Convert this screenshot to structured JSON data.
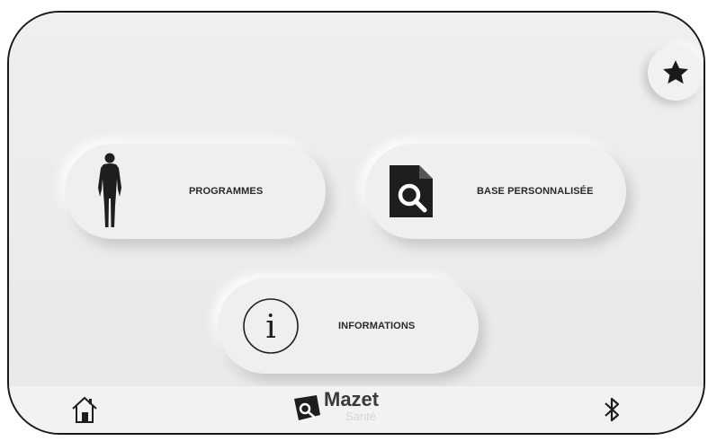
{
  "menu": {
    "programmes_label": "PROGRAMMES",
    "base_label": "BASE PERSONNALISÉE",
    "info_label": "INFORMATIONS"
  },
  "logo": {
    "name": "Mazet",
    "sub": "Santé"
  },
  "icons": {
    "favorite": "star-icon",
    "programmes": "human-body-icon",
    "base": "document-search-icon",
    "info": "info-icon",
    "home": "home-icon",
    "bluetooth": "bluetooth-icon"
  }
}
